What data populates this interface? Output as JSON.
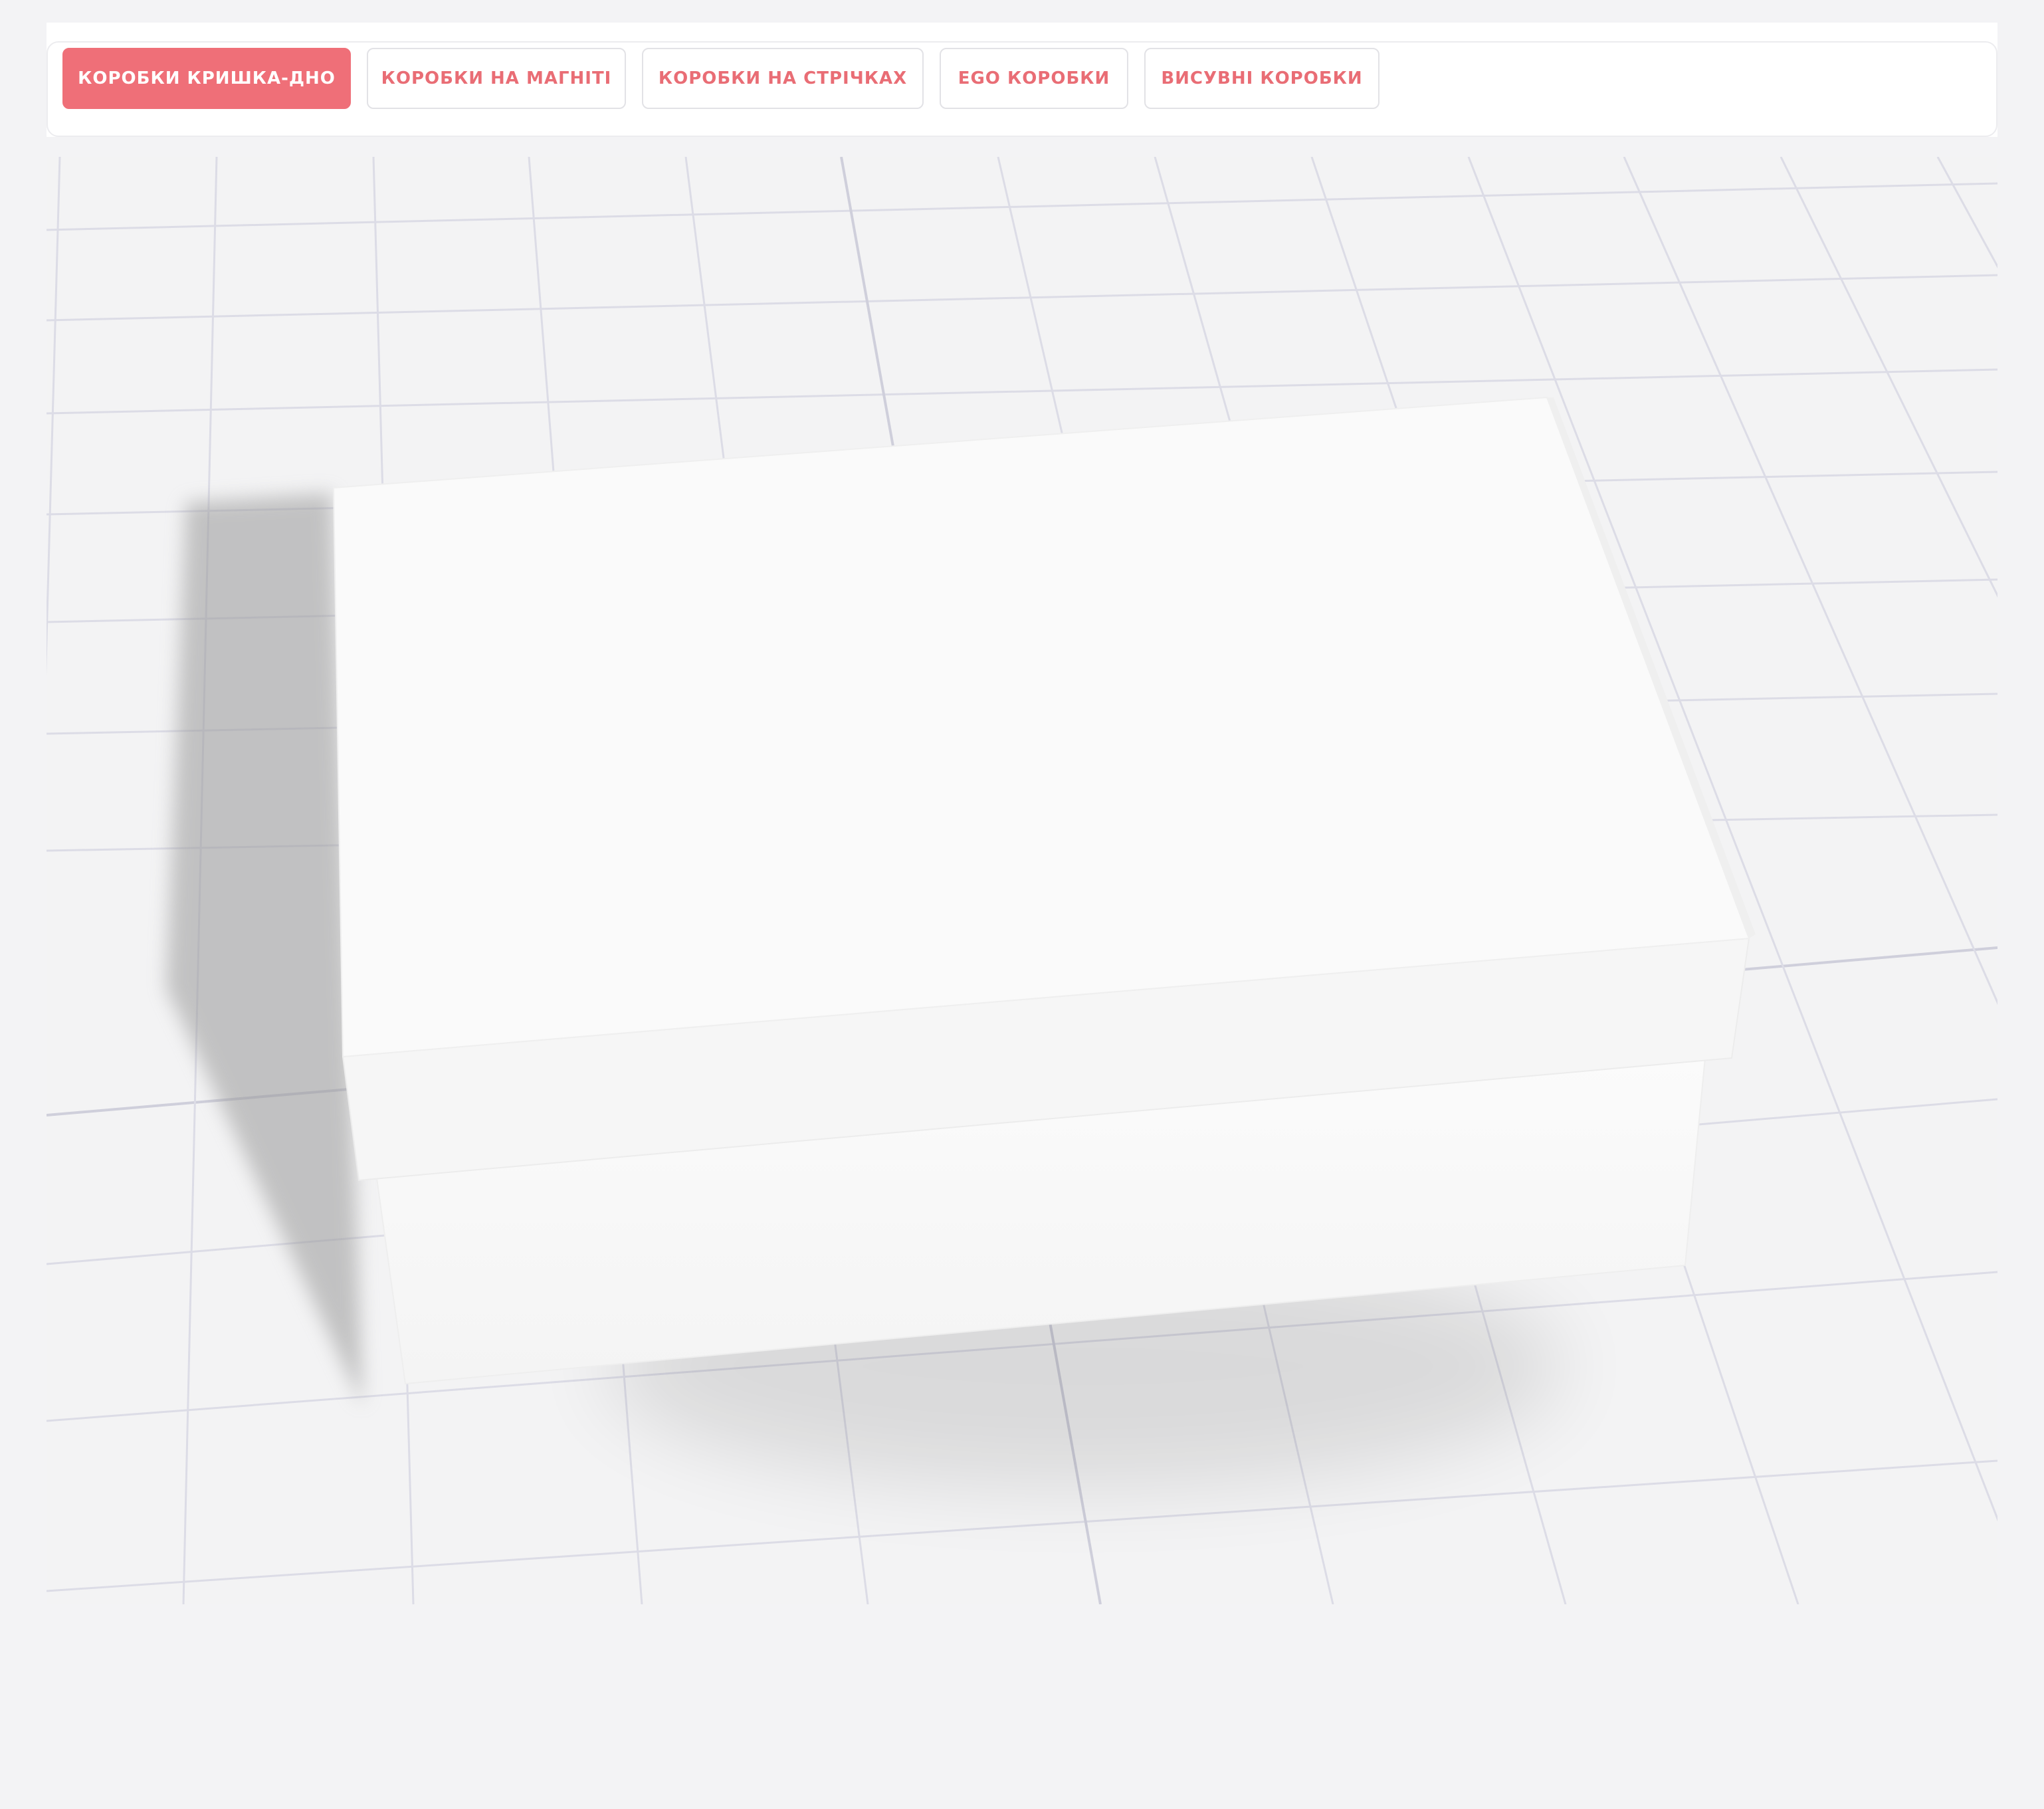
{
  "tabs": [
    {
      "label": "КОРОБКИ КРИШКА-ДНО",
      "active": true
    },
    {
      "label": "КОРОБКИ НА МАГНІТІ",
      "active": false
    },
    {
      "label": "КОРОБКИ НА СТРІЧКАХ",
      "active": false
    },
    {
      "label": "EGO КОРОБКИ",
      "active": false
    },
    {
      "label": "ВИСУВНІ КОРОБКИ",
      "active": false
    }
  ],
  "colors": {
    "accent": "#ef6f78",
    "tab_text": "#e96d75",
    "background": "#f3f3f5",
    "grid_line": "#dcdce6",
    "box_face": "#fafafa"
  },
  "viewer": {
    "content": "3d-box-preview"
  }
}
